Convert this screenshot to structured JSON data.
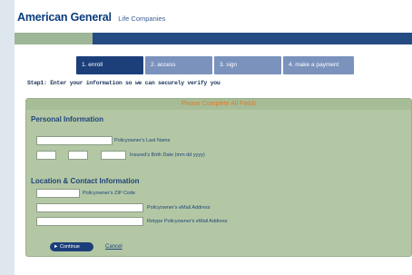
{
  "header": {
    "brand": "American General",
    "brand_sub": "Life Companies"
  },
  "steps": [
    {
      "label": "1. enroll",
      "active": true
    },
    {
      "label": "2. access",
      "active": false
    },
    {
      "label": "3. sign",
      "active": false
    },
    {
      "label": "4. make a payment",
      "active": false
    }
  ],
  "instruction": "Step1: Enter your information so we can securely verify you",
  "form": {
    "header": "Please Complete All Fields",
    "personal": {
      "title": "Personal Information",
      "last_name_label": "Policyowner's Last Name",
      "dob_label": "Insured's Birth Date (mm dd yyyy)",
      "last_name_value": "",
      "dob_mm": "",
      "dob_dd": "",
      "dob_yyyy": ""
    },
    "contact": {
      "title": "Location & Contact Information",
      "zip_label": "Policyowner's ZIP Code",
      "email_label": "Policyowner's eMail Address",
      "email_retype_label": "Retype Policyowner's eMail Address",
      "zip_value": "",
      "email_value": "",
      "email_retype_value": ""
    },
    "continue_label": "► Continue",
    "cancel_label": "Cancel"
  },
  "colors": {
    "brand_blue": "#0a3c7d",
    "step_active": "#1c3f7a",
    "step_inactive": "#7b92bd",
    "form_bg": "#b3c7a5",
    "form_header_text": "#e07a2b"
  }
}
